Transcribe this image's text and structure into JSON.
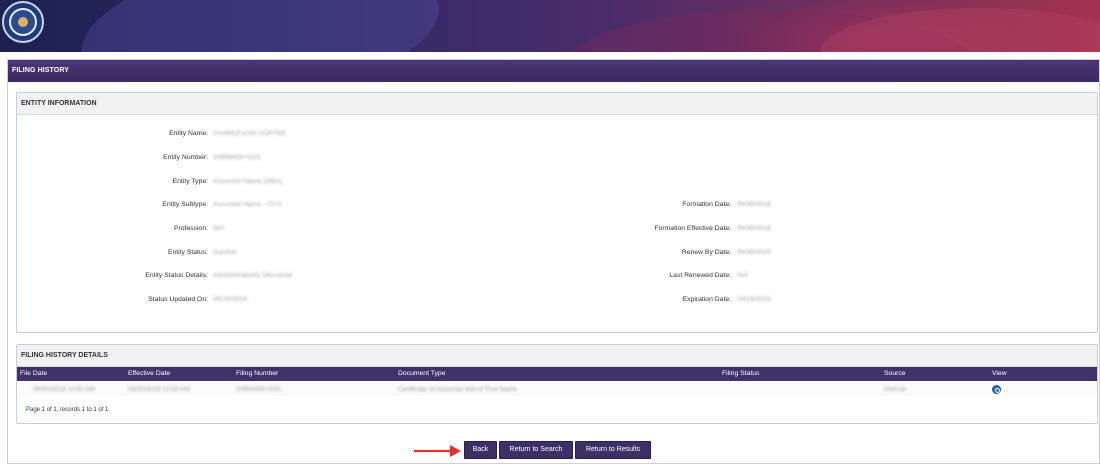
{
  "colors": {
    "accent": "#3e2f66",
    "header": "#4b3578",
    "arrow": "#e0322b",
    "view_icon": "#2a6fc9"
  },
  "page": {
    "title": "FILING HISTORY"
  },
  "entity_info": {
    "title": "ENTITY INFORMATION",
    "left": [
      {
        "label": "Entity Name:",
        "value": "CHARLEVOIX COFFEE"
      },
      {
        "label": "Entity Number:",
        "value": "10993459-0151"
      },
      {
        "label": "Entity Type:",
        "value": "Assumed Name (DBA)"
      },
      {
        "label": "Entity Subtype:",
        "value": "Assumed Name - CCC"
      },
      {
        "label": "Profession:",
        "value": "N/A"
      },
      {
        "label": "Entity Status:",
        "value": "Inactive"
      },
      {
        "label": "Entity Status Details:",
        "value": "Administratively Dissolved"
      },
      {
        "label": "Status Updated On:",
        "value": "09/16/2024"
      }
    ],
    "right": [
      {
        "label": "Formation Date:",
        "value": "09/30/2018"
      },
      {
        "label": "Formation Effective Date:",
        "value": "09/30/2018"
      },
      {
        "label": "Renew By Date:",
        "value": "09/30/2023"
      },
      {
        "label": "Last Renewed Date:",
        "value": "N/A"
      },
      {
        "label": "Expiration Date:",
        "value": "09/16/2024"
      }
    ]
  },
  "filing_history": {
    "title": "FILING HISTORY DETAILS",
    "columns": [
      "File Date",
      "Effective Date",
      "Filing Number",
      "Document Type",
      "Filing Status",
      "Source",
      "View"
    ],
    "rows": [
      {
        "file_date": "09/30/2018 12:00 AM",
        "effective_date": "09/30/2018 12:00 AM",
        "filing_number": "10993459-0151",
        "document_type": "Certificate of Assumed and of True Name",
        "filing_status": "",
        "source": "Internal",
        "view_icon": "search-icon"
      }
    ],
    "pager": "Page 1 of 1, records 1 to 1 of 1"
  },
  "buttons": {
    "back": "Back",
    "return_search": "Return to Search",
    "return_results": "Return to Results"
  }
}
